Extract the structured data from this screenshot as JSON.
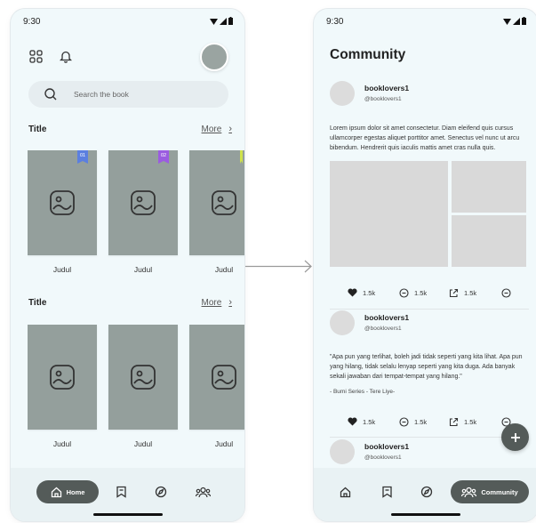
{
  "status": {
    "time": "9:30"
  },
  "home": {
    "search_placeholder": "Search the book",
    "sections": [
      {
        "title": "Title",
        "more": "More",
        "books": [
          {
            "label": "Judul",
            "badge": "01",
            "badge_color": "#5b7fe0"
          },
          {
            "label": "Judul",
            "badge": "02",
            "badge_color": "#9b5ce0"
          },
          {
            "label": "Judul",
            "badge": "",
            "badge_color": "#cfe24a"
          }
        ]
      },
      {
        "title": "Title",
        "more": "More",
        "books": [
          {
            "label": "Judul"
          },
          {
            "label": "Judul"
          },
          {
            "label": "Judul"
          }
        ]
      }
    ],
    "nav": {
      "home_label": "Home"
    }
  },
  "community": {
    "title": "Community",
    "posts": [
      {
        "user": "booklovers1",
        "handle": "@booklovers1",
        "text": "Lorem ipsum dolor sit amet consectetur. Diam eleifend quis cursus ullamcorper egestas aliquet porttitor amet. Senectus vel nunc ut arcu bibendum. Hendrerit quis iaculis mattis amet cras nulla quis.",
        "likes": "1.5k",
        "comments": "1.5k",
        "shares": "1.5k"
      },
      {
        "user": "booklovers1",
        "handle": "@booklovers1",
        "text": "\"Apa pun yang terlihat, boleh jadi tidak seperti yang kita lihat. Apa pun yang hilang, tidak selalu lenyap seperti yang kita duga. Ada banyak sekali jawaban dari tempat-tempat yang hilang.\"",
        "source": "- Bumi Series - Tere Liye-",
        "likes": "1.5k",
        "comments": "1.5k",
        "shares": "1.5k"
      },
      {
        "user": "booklovers1",
        "handle": "@booklovers1"
      }
    ],
    "nav": {
      "community_label": "Community"
    }
  },
  "colors": {
    "background": "#f1f9fb",
    "cover": "#949f9c",
    "pill": "#545b59"
  }
}
